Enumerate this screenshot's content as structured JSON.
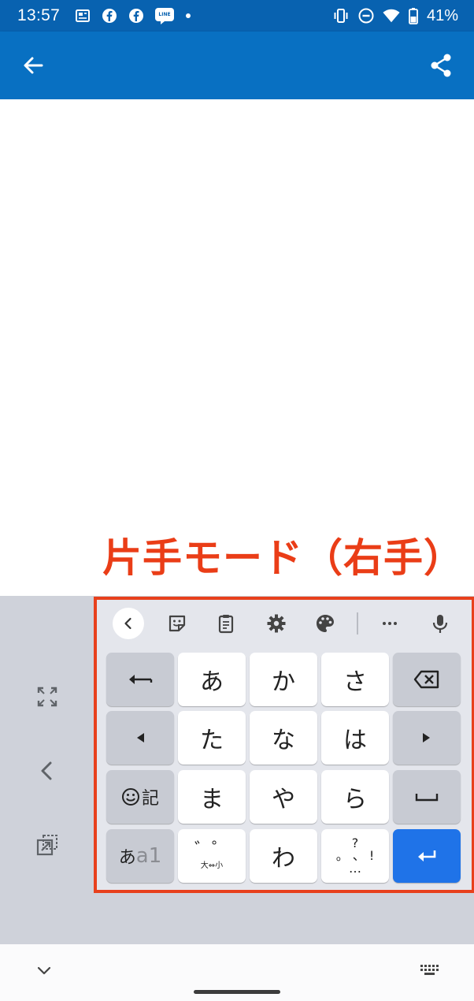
{
  "status_bar": {
    "time": "13:57",
    "battery_text": "41%",
    "left_icons": [
      "news-icon",
      "facebook-icon",
      "facebook-icon",
      "line-manga-icon",
      "dot-icon"
    ],
    "right_icons": [
      "vibrate-icon",
      "dnd-icon",
      "wifi-icon",
      "battery-icon"
    ],
    "line_badge": "LINE"
  },
  "annotation": {
    "text": "片手モード（右手）"
  },
  "keyboard": {
    "rows": [
      [
        "あ",
        "か",
        "さ"
      ],
      [
        "た",
        "な",
        "は"
      ],
      [
        "ま",
        "や",
        "ら"
      ]
    ],
    "emoji_label": "記",
    "mode_label_small": "あ",
    "mode_label_big": "a1",
    "dakuten_top": "゛゜",
    "dakuten_bottom": "大⇔小",
    "wa": "わ",
    "punct_top": "?",
    "punct_mid": "。 、 !",
    "punct_bottom": "…"
  },
  "colors": {
    "status_bar": "#0862b0",
    "app_bar": "#0870c2",
    "annotation": "#ea3d17",
    "enter_key": "#1f73e8",
    "keyboard_bg": "#cfd2da"
  }
}
